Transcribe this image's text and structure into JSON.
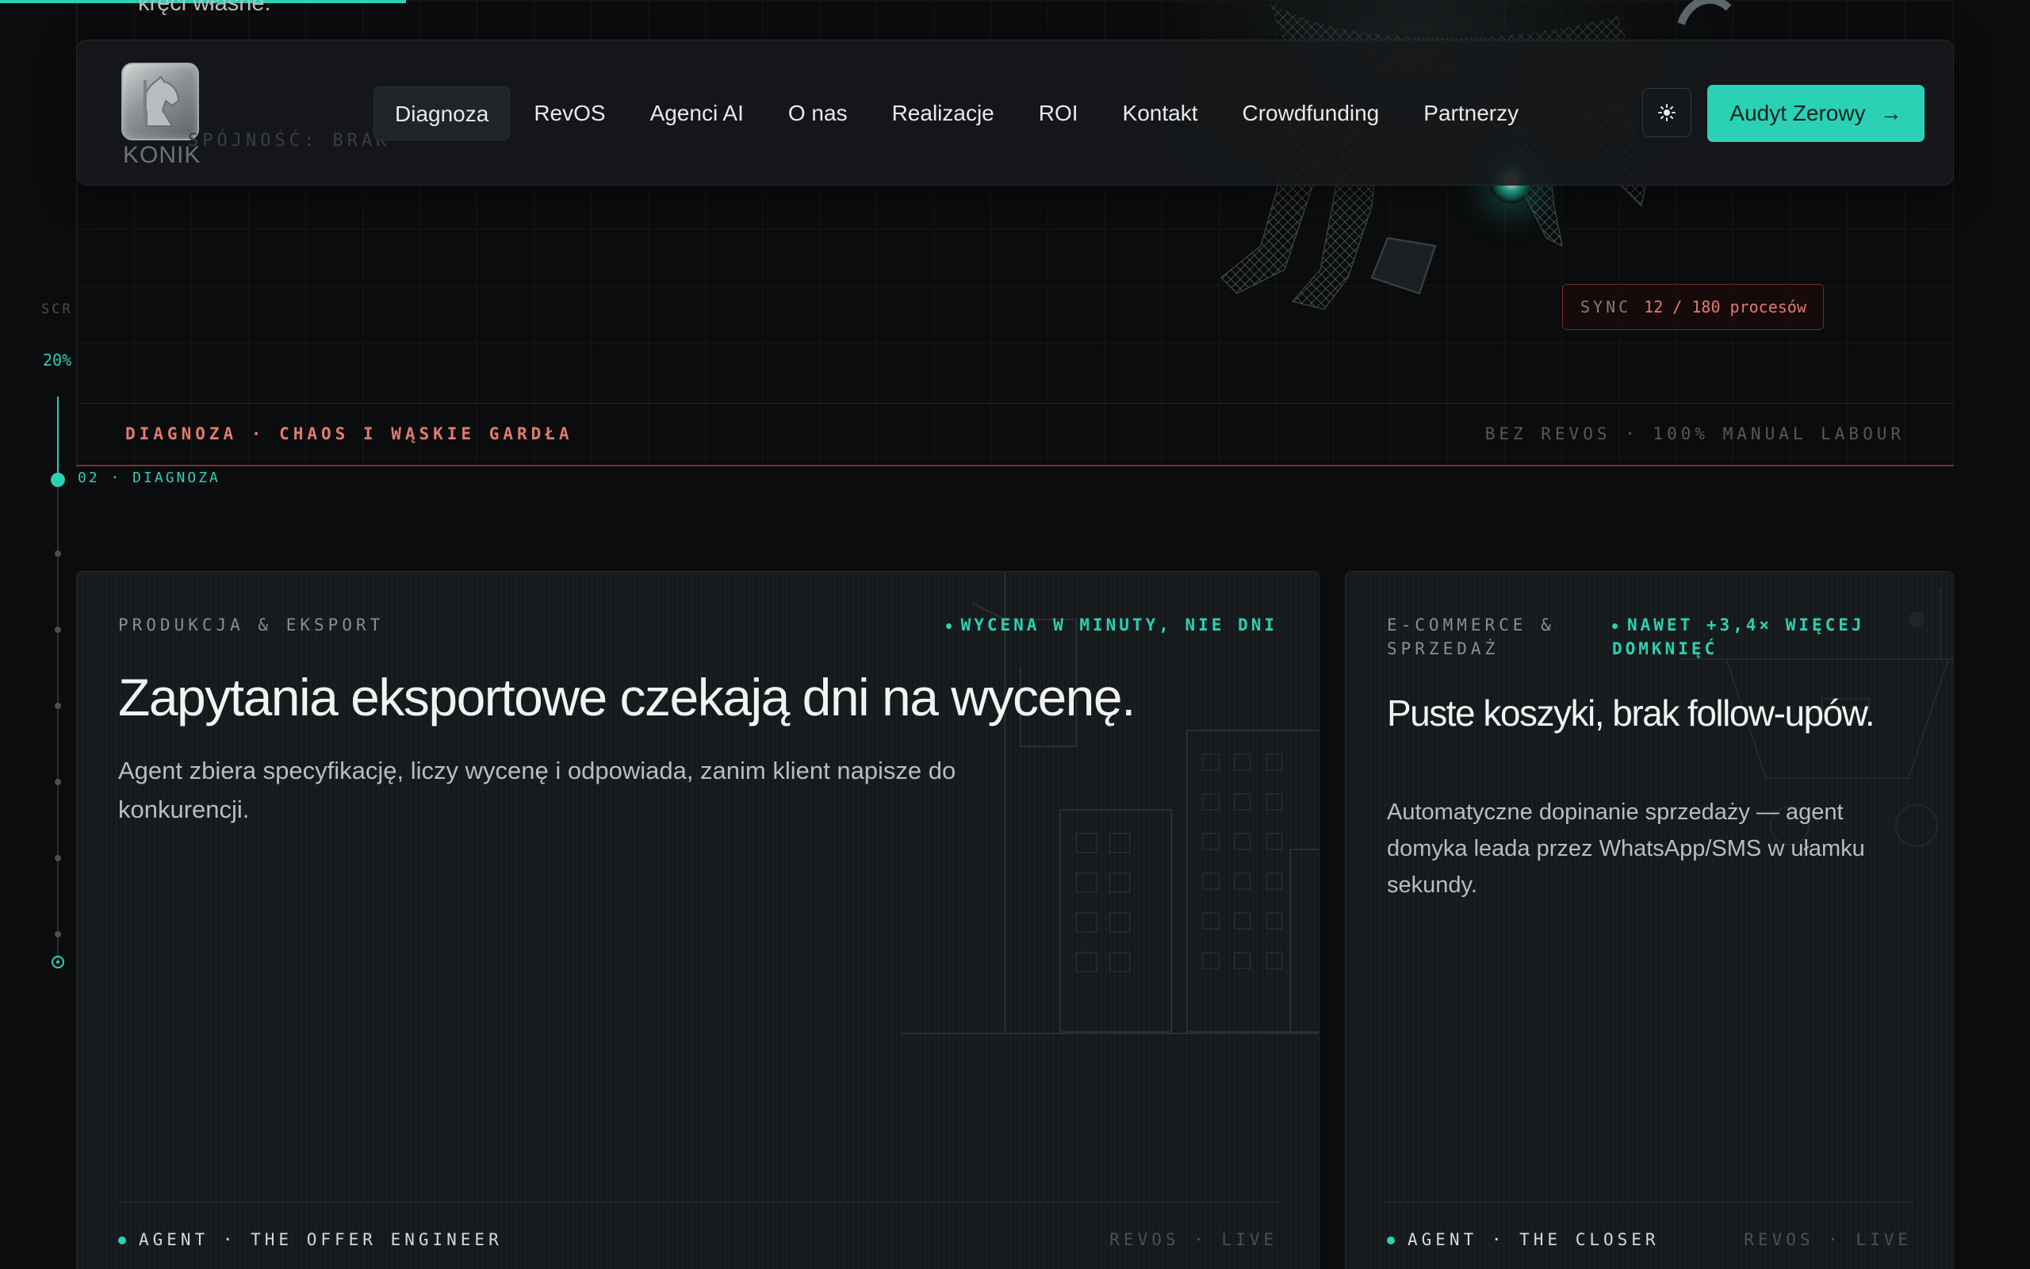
{
  "hero": {
    "partial_text": "kręci własne.",
    "ghost_text": "SPÓJNOŚĆ: BRAK"
  },
  "logo": {
    "text": "KONIK"
  },
  "nav": {
    "items": [
      {
        "label": "Diagnoza",
        "active": true
      },
      {
        "label": "RevOS"
      },
      {
        "label": "Agenci AI"
      },
      {
        "label": "O nas"
      },
      {
        "label": "Realizacje"
      },
      {
        "label": "ROI"
      },
      {
        "label": "Kontakt"
      },
      {
        "label": "Crowdfunding"
      },
      {
        "label": "Partnerzy"
      }
    ],
    "theme_icon": "sun-icon",
    "cta_label": "Audyt Zerowy",
    "cta_arrow": "→"
  },
  "sync": {
    "label": "SYNC",
    "value": "12 / 180 procesów"
  },
  "scroll": {
    "label": "SCR",
    "percent": "20%",
    "progress": 0.2,
    "section_marker": "02 · DIAGNOZA"
  },
  "diagnosis": {
    "title": "DIAGNOZA · CHAOS I WĄSKIE GARDŁA",
    "side": "BEZ REVOS · 100% MANUAL LABOUR"
  },
  "cards": [
    {
      "sector": "PRODUKCJA & EKSPORT",
      "tag": "WYCENA W MINUTY, NIE DNI",
      "title": "Zapytania eksportowe czekają dni na wycenę.",
      "description": "Agent zbiera specyfikację, liczy wycenę i odpowiada, zanim klient napisze do konkurencji.",
      "agent": "AGENT · THE OFFER ENGINEER",
      "status": "REVOS · LIVE"
    },
    {
      "sector": "E-COMMERCE & SPRZEDAŻ",
      "tag": "NAWET +3,4× WIĘCEJ DOMKNIĘĆ",
      "title": "Puste koszyki, brak follow-upów.",
      "description": "Automatyczne dopinanie sprzedaży — agent domyka leada przez WhatsApp/SMS w ułamku sekundy.",
      "agent": "AGENT · THE CLOSER",
      "status": "REVOS · LIVE"
    }
  ],
  "colors": {
    "accent": "#2bd1b4",
    "warning": "#e37a6e",
    "background": "#0b0c0d"
  }
}
